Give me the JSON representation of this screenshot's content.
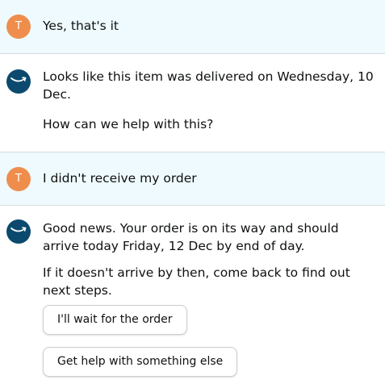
{
  "user_avatar_letter": "T",
  "messages": [
    {
      "text": "Yes, that's it"
    },
    {
      "line1": "Looks like this item was delivered on Wednesday, 10 Dec.",
      "line2": "How can we help with this?"
    },
    {
      "text": "I didn't receive my order"
    },
    {
      "line1": "Good news. Your order is on its way and should arrive today Friday, 12 Dec by end of day.",
      "line2": "If it doesn't arrive by then, come back to find out next steps."
    }
  ],
  "buttons": {
    "wait": "I'll wait for the order",
    "help": "Get help with something else"
  },
  "colors": {
    "user_bg": "#eefafd",
    "user_avatar": "#ef8e4c",
    "bot_avatar": "#0b4a6e"
  },
  "icons": {
    "user": "letter-avatar",
    "bot": "amazon-smile-icon"
  }
}
